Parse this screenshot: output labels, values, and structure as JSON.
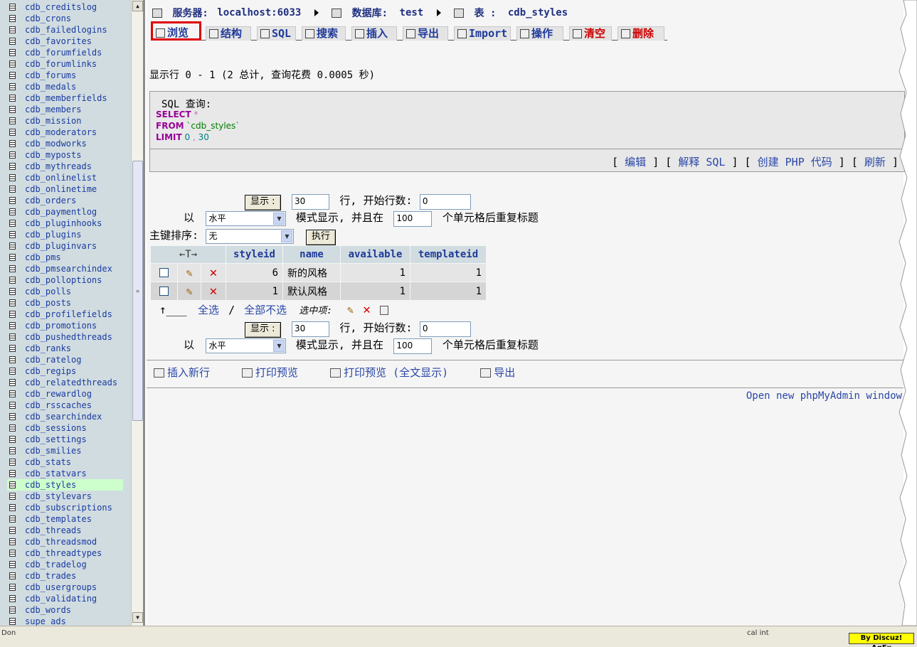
{
  "sidebar": {
    "tables": [
      "cdb_creditslog",
      "cdb_crons",
      "cdb_failedlogins",
      "cdb_favorites",
      "cdb_forumfields",
      "cdb_forumlinks",
      "cdb_forums",
      "cdb_medals",
      "cdb_memberfields",
      "cdb_members",
      "cdb_mission",
      "cdb_moderators",
      "cdb_modworks",
      "cdb_myposts",
      "cdb_mythreads",
      "cdb_onlinelist",
      "cdb_onlinetime",
      "cdb_orders",
      "cdb_paymentlog",
      "cdb_pluginhooks",
      "cdb_plugins",
      "cdb_pluginvars",
      "cdb_pms",
      "cdb_pmsearchindex",
      "cdb_polloptions",
      "cdb_polls",
      "cdb_posts",
      "cdb_profilefields",
      "cdb_promotions",
      "cdb_pushedthreads",
      "cdb_ranks",
      "cdb_ratelog",
      "cdb_regips",
      "cdb_relatedthreads",
      "cdb_rewardlog",
      "cdb_rsscaches",
      "cdb_searchindex",
      "cdb_sessions",
      "cdb_settings",
      "cdb_smilies",
      "cdb_stats",
      "cdb_statvars",
      "cdb_styles",
      "cdb_stylevars",
      "cdb_subscriptions",
      "cdb_templates",
      "cdb_threads",
      "cdb_threadsmod",
      "cdb_threadtypes",
      "cdb_tradelog",
      "cdb_trades",
      "cdb_usergroups",
      "cdb_validating",
      "cdb_words",
      "supe_ads"
    ],
    "selected": "cdb_styles"
  },
  "breadcrumb": {
    "server_label": "服务器:",
    "server": "localhost:6033",
    "db_label": "数据库:",
    "db": "test",
    "table_label": "表 :",
    "table": "cdb_styles"
  },
  "tabs": [
    {
      "label": "浏览",
      "icon": "browse-icon"
    },
    {
      "label": "结构",
      "icon": "structure-icon"
    },
    {
      "label": "SQL",
      "icon": "sql-icon"
    },
    {
      "label": "搜索",
      "icon": "search-icon"
    },
    {
      "label": "插入",
      "icon": "insert-icon"
    },
    {
      "label": "导出",
      "icon": "export-icon"
    },
    {
      "label": "Import",
      "icon": "import-icon"
    },
    {
      "label": "操作",
      "icon": "operations-icon"
    },
    {
      "label": "清空",
      "icon": "empty-icon"
    },
    {
      "label": "删除",
      "icon": "drop-icon"
    }
  ],
  "summary": "显示行 0 - 1 (2 总计, 查询花费 0.0005 秒)",
  "sql": {
    "legend": "SQL 查询:",
    "kw_select": "SELECT",
    "star": "*",
    "kw_from": "FROM",
    "table": "`cdb_styles`",
    "kw_limit": "LIMIT",
    "limit_start": "0",
    "comma": ",",
    "limit_count": "30",
    "actions": {
      "edit": "编辑",
      "explain": "解释 SQL",
      "create_php": "创建 PHP 代码",
      "refresh": "刷新"
    }
  },
  "nav": {
    "show_button": "显示 :",
    "rows_value": "30",
    "rows_text": "行, 开始行数:",
    "start_value": "0",
    "prefix_with": "以",
    "mode_value": "水平",
    "mode_text": "模式显示, 并且在",
    "repeat_value": "100",
    "repeat_text": "个单元格后重复标题",
    "sort_label": "主键排序:",
    "sort_value": "无",
    "go_button": "执行"
  },
  "results": {
    "arrows": "←T→",
    "columns": [
      "styleid",
      "name",
      "available",
      "templateid"
    ],
    "rows": [
      {
        "styleid": "6",
        "name": "新的风格",
        "available": "1",
        "templateid": "1"
      },
      {
        "styleid": "1",
        "name": "默认风格",
        "available": "1",
        "templateid": "1"
      }
    ]
  },
  "selection": {
    "check_all": "全选",
    "sep": "/",
    "uncheck_all": "全部不选",
    "with_selected": "选中项:"
  },
  "footer": {
    "insert_row": "插入新行",
    "print_view": "打印预览",
    "print_view_full": "打印预览 (全文显示)",
    "export": "导出",
    "new_window": "Open new phpMyAdmin window"
  },
  "statusbar": {
    "left": "Don",
    "right": "cal int"
  },
  "badge": "By Discuz! AgFx",
  "colors": {
    "sidebar_bg": "#d0dce0",
    "selected_bg": "#ccffcc",
    "link": "#2a47a6",
    "active_tab_border": "#e00000"
  }
}
